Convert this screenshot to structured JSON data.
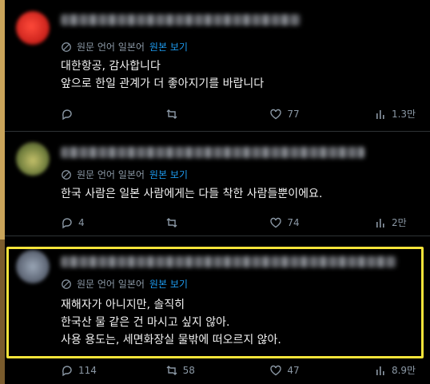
{
  "colors": {
    "highlight": "#f7e43a",
    "link": "#1d9bf0",
    "muted": "#8b98a5"
  },
  "tweets": [
    {
      "translate": {
        "label": "원문 언어 일본어",
        "link": "원본 보기"
      },
      "lines": [
        "대한항공, 감사합니다",
        "앞으로 한일 관계가 더 좋아지기를 바랍니다"
      ],
      "actions": {
        "reply": "",
        "retweet": "",
        "like": "77",
        "views": "1.3만"
      }
    },
    {
      "translate": {
        "label": "원문 언어 일본어",
        "link": "원본 보기"
      },
      "lines": [
        "한국 사람은 일본 사람에게는 다들 착한 사람들뿐이에요."
      ],
      "actions": {
        "reply": "4",
        "retweet": "",
        "like": "74",
        "views": "2만"
      }
    },
    {
      "translate": {
        "label": "원문 언어 일본어",
        "link": "원본 보기"
      },
      "lines": [
        "재해자가 아니지만, 솔직히",
        "한국산 물 같은 건 마시고 싶지 않아.",
        "사용 용도는, 세면화장실 물밖에 떠오르지 않아."
      ],
      "actions": {
        "reply": "114",
        "retweet": "58",
        "like": "47",
        "views": "8.9만"
      }
    }
  ]
}
